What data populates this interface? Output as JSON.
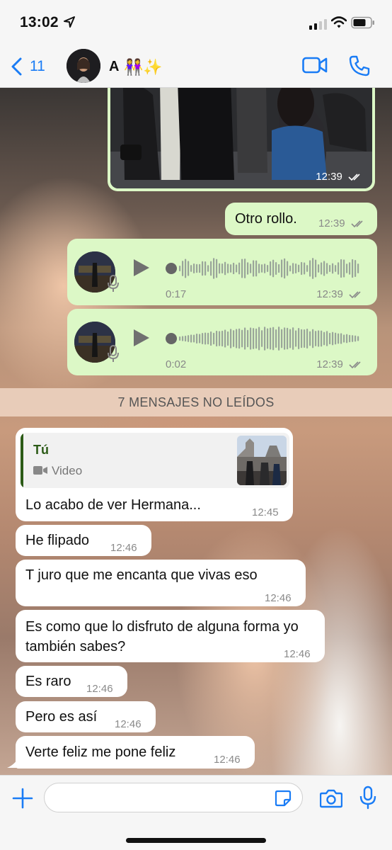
{
  "status_bar": {
    "time": "13:02"
  },
  "header": {
    "back_count": "11",
    "contact_name": "A",
    "contact_emoji": "👭✨"
  },
  "messages": {
    "image": {
      "time": "12:39"
    },
    "otro_rollo": {
      "text": "Otro rollo.",
      "time": "12:39"
    },
    "voice1": {
      "duration": "0:17",
      "time": "12:39"
    },
    "voice2": {
      "duration": "0:02",
      "time": "12:39"
    },
    "unread_banner": "7 MENSAJES NO LEÍDOS",
    "reply": {
      "quoted_name": "Tú",
      "quoted_type": "Video",
      "text": "Lo acabo de ver Hermana...",
      "time": "12:45"
    },
    "incoming": [
      {
        "text": "He flipado",
        "time": "12:46"
      },
      {
        "text": "T juro que me encanta que vivas eso",
        "time": "12:46"
      },
      {
        "text": "Es como que lo disfruto de alguna forma yo también sabes?",
        "time": "12:46"
      },
      {
        "text": "Es raro",
        "time": "12:46"
      },
      {
        "text": "Pero es así",
        "time": "12:46"
      },
      {
        "text": "Verte feliz me pone feliz",
        "time": "12:46"
      }
    ]
  },
  "input": {
    "placeholder": ""
  },
  "icons": {
    "back": "chevron-left-icon",
    "video_call": "video-camera-icon",
    "phone_call": "phone-icon",
    "play": "play-icon",
    "plus": "plus-icon",
    "sticker": "sticker-icon",
    "camera": "camera-icon",
    "mic": "microphone-icon"
  },
  "colors": {
    "accent": "#1a7cf5",
    "outgoing_bubble": "#dcf8c6",
    "incoming_bubble": "#ffffff",
    "quote_name": "#2c5b17"
  }
}
